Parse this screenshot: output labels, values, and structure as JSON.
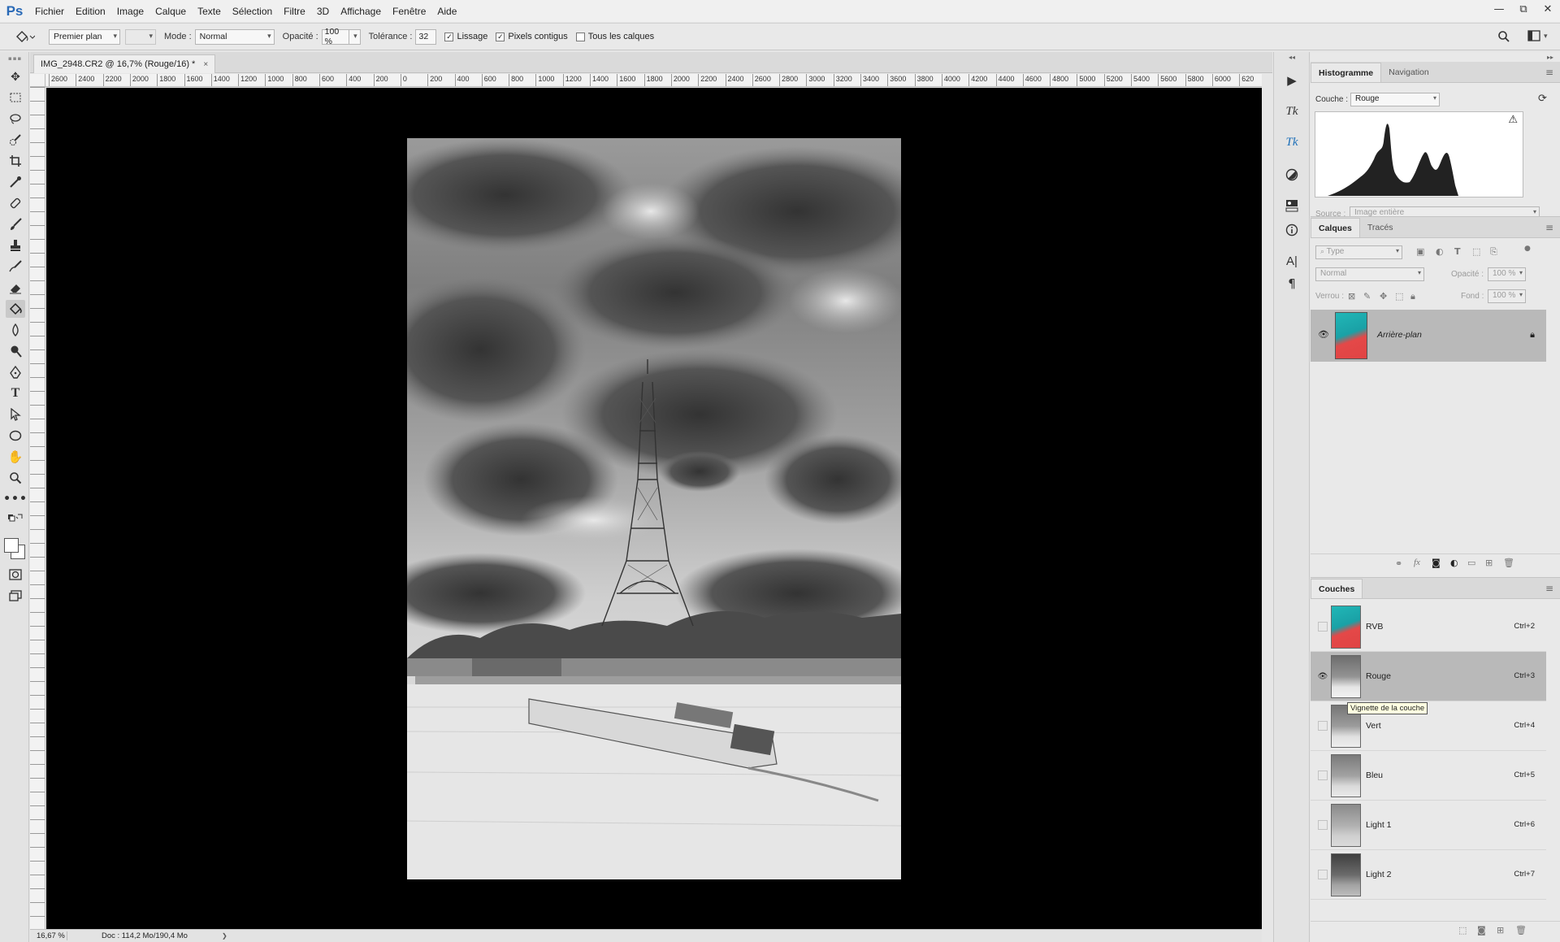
{
  "app": {
    "logo": "Ps"
  },
  "menu": [
    "Fichier",
    "Edition",
    "Image",
    "Calque",
    "Texte",
    "Sélection",
    "Filtre",
    "3D",
    "Affichage",
    "Fenêtre",
    "Aide"
  ],
  "window_controls": {
    "minimize": "—",
    "restore": "⧉",
    "close": "✕"
  },
  "options": {
    "preset": "Premier plan",
    "mode_label": "Mode :",
    "mode_value": "Normal",
    "opacity_label": "Opacité :",
    "opacity_value": "100 %",
    "tolerance_label": "Tolérance :",
    "tolerance_value": "32",
    "smoothing_label": "Lissage",
    "smoothing_checked": true,
    "contiguous_label": "Pixels contigus",
    "contiguous_checked": true,
    "all_layers_label": "Tous les calques",
    "all_layers_checked": false
  },
  "document": {
    "tab_title": "IMG_2948.CR2 @ 16,7% (Rouge/16) *",
    "close": "×"
  },
  "ruler_h": [
    "2600",
    "2400",
    "2200",
    "2000",
    "1800",
    "1600",
    "1400",
    "1200",
    "1000",
    "800",
    "600",
    "400",
    "200",
    "0",
    "200",
    "400",
    "600",
    "800",
    "1000",
    "1200",
    "1400",
    "1600",
    "1800",
    "2000",
    "2200",
    "2400",
    "2600",
    "2800",
    "3000",
    "3200",
    "3400",
    "3600",
    "3800",
    "4000",
    "4200",
    "4400",
    "4600",
    "4800",
    "5000",
    "5200",
    "5400",
    "5600",
    "5800",
    "6000",
    "620"
  ],
  "status": {
    "zoom": "16,67 %",
    "doc": "Doc : 114,2 Mo/190,4 Mo",
    "arrow": "❯"
  },
  "histogram": {
    "tabs": [
      "Histogramme",
      "Navigation"
    ],
    "channel_label": "Couche :",
    "channel_value": "Rouge",
    "source_label": "Source :",
    "source_value": "Image entière",
    "warning": "⚠"
  },
  "layers": {
    "tabs": [
      "Calques",
      "Tracés"
    ],
    "filter_placeholder": "Type",
    "blend_mode": "Normal",
    "opacity_label": "Opacité :",
    "opacity_value": "100 %",
    "lock_label": "Verrou :",
    "fill_label": "Fond :",
    "fill_value": "100 %",
    "items": [
      {
        "name": "Arrière-plan",
        "locked": true,
        "visible": true
      }
    ]
  },
  "channels": {
    "title": "Couches",
    "items": [
      {
        "name": "RVB",
        "shortcut": "Ctrl+2",
        "visible": false,
        "selected": false
      },
      {
        "name": "Rouge",
        "shortcut": "Ctrl+3",
        "visible": true,
        "selected": true
      },
      {
        "name": "Vert",
        "shortcut": "Ctrl+4",
        "visible": false,
        "selected": false
      },
      {
        "name": "Bleu",
        "shortcut": "Ctrl+5",
        "visible": false,
        "selected": false
      },
      {
        "name": "Light 1",
        "shortcut": "Ctrl+6",
        "visible": false,
        "selected": false
      },
      {
        "name": "Light 2",
        "shortcut": "Ctrl+7",
        "visible": false,
        "selected": false
      }
    ],
    "tooltip": "Vignette de la couche"
  },
  "colors": {
    "accent": "#2a6ab7",
    "canvas_bg": "#000000",
    "selected_row": "#b9b9b9",
    "thumb_cyan": "#1fb3b5",
    "thumb_red": "#e04848"
  }
}
